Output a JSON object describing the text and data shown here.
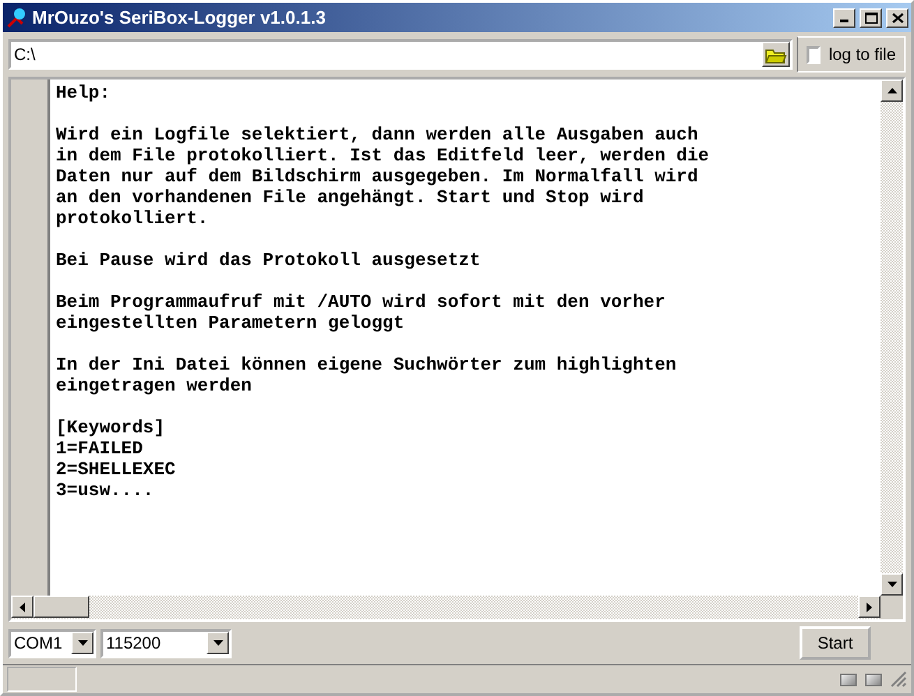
{
  "window": {
    "title": "MrOuzo's SeriBox-Logger v1.0.1.3"
  },
  "path_field": {
    "value": "C:\\"
  },
  "log_to_file": {
    "label": "log to file",
    "checked": false
  },
  "log": {
    "paragraphs": [
      [
        "Help:"
      ],
      [
        "Wird ein Logfile selektiert, dann werden alle Ausgaben auch",
        "in dem File protokolliert. Ist das Editfeld leer, werden die",
        "Daten nur auf dem Bildschirm ausgegeben. Im Normalfall wird",
        "an den vorhandenen File angehängt. Start und Stop wird",
        "protokolliert."
      ],
      [
        "Bei Pause wird das Protokoll ausgesetzt"
      ],
      [
        "Beim Programmaufruf mit /AUTO wird sofort mit den vorher",
        "eingestellten Parametern geloggt"
      ],
      [
        "In der Ini Datei können eigene Suchwörter zum highlighten",
        "eingetragen werden"
      ],
      [
        "[Keywords]",
        "1=FAILED",
        "2=SHELLEXEC",
        "3=usw...."
      ]
    ]
  },
  "port": {
    "value": "COM1"
  },
  "baud": {
    "value": "115200"
  },
  "start_button": {
    "label": "Start"
  }
}
